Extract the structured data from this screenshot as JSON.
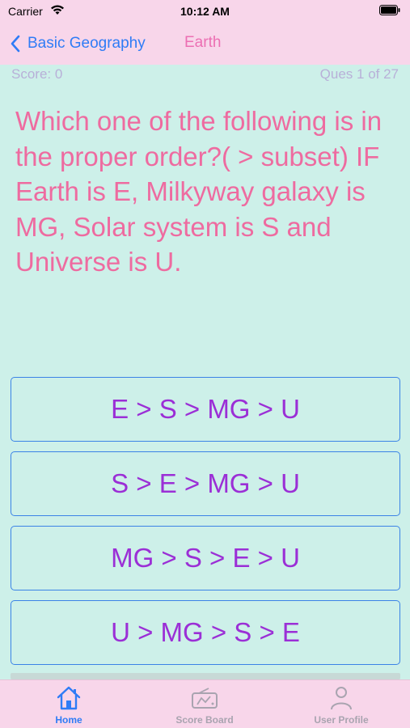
{
  "status_bar": {
    "carrier": "Carrier",
    "time": "10:12 AM"
  },
  "nav": {
    "back_label": "Basic Geography",
    "title": "Earth"
  },
  "quiz": {
    "score": "Score: 0",
    "progress": "Ques 1 of 27",
    "question": "Which one of the following is in the proper order?( > subset) IF Earth is E, Milkyway galaxy is MG, Solar system is S and Universe is U.",
    "options": [
      "E > S > MG > U",
      "S > E > MG > U",
      "MG > S > E > U",
      "U > MG > S > E"
    ]
  },
  "tabs": [
    {
      "label": "Home",
      "icon": "home-icon",
      "active": true
    },
    {
      "label": "Score Board",
      "icon": "scoreboard-icon",
      "active": false
    },
    {
      "label": "User Profile",
      "icon": "user-icon",
      "active": false
    }
  ],
  "colors": {
    "background": "#cdf0e9",
    "top_bar": "#f8d6ea",
    "accent_blue": "#2f7cf6",
    "question_pink": "#ee6ba0",
    "option_purple": "#9b2fd6"
  }
}
